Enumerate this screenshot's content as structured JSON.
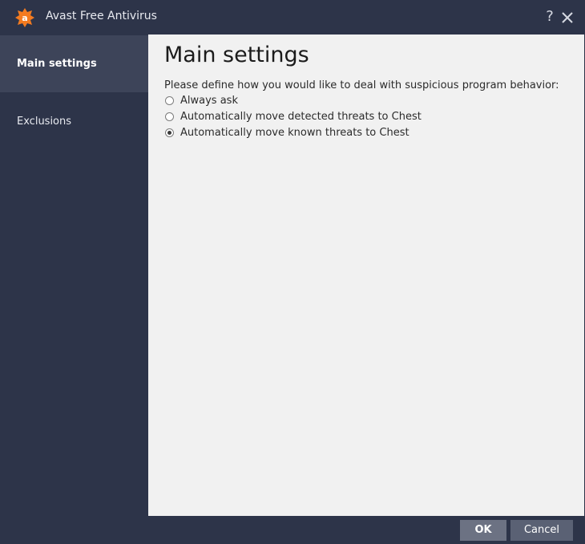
{
  "window": {
    "title": "Avast Free Antivirus",
    "help_label": "?",
    "brand_color": "#f47b20",
    "logo_icon": "avast-logo-icon",
    "close_icon": "close-icon"
  },
  "sidebar": {
    "items": [
      {
        "label": "Main settings",
        "active": true
      },
      {
        "label": "Exclusions",
        "active": false
      }
    ]
  },
  "main": {
    "title": "Main settings",
    "prompt": "Please define how you would like to deal with suspicious program behavior:",
    "options": [
      {
        "label": "Always ask",
        "checked": false
      },
      {
        "label": "Automatically move detected threats to Chest",
        "checked": false
      },
      {
        "label": "Automatically move known threats to Chest",
        "checked": true
      }
    ]
  },
  "footer": {
    "ok_label": "OK",
    "cancel_label": "Cancel"
  }
}
